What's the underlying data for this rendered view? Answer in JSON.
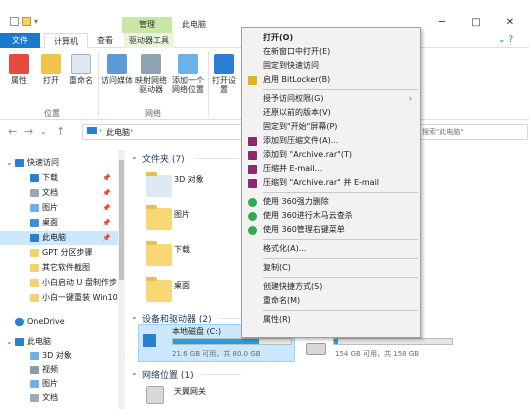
{
  "window": {
    "title": "此电脑",
    "context_tab": "管理",
    "controls": [
      "─",
      "□",
      "✕"
    ]
  },
  "ribbon_tabs": {
    "file": "文件",
    "computer": "计算机",
    "view": "查看",
    "drive_tools": "驱动器工具"
  },
  "ribbon": {
    "properties": "属性",
    "open": "打开",
    "rename": "重命名",
    "access_media": "访问媒体",
    "map_drive": "映射网络驱动器",
    "add_location": "添加一个网络位置",
    "open_settings": "打开设置",
    "group_location": "位置",
    "group_network": "网络"
  },
  "address": {
    "path": "此电脑",
    "search_placeholder": "搜索\"此电脑\""
  },
  "nav": {
    "quick_access": "快速访问",
    "items": [
      {
        "label": "下载",
        "pin": "📌"
      },
      {
        "label": "文档",
        "pin": "📌"
      },
      {
        "label": "图片",
        "pin": "📌"
      },
      {
        "label": "桌面",
        "pin": "📌"
      },
      {
        "label": "此电脑",
        "pin": "📌"
      },
      {
        "label": "GPT 分区步骤",
        "pin": ""
      },
      {
        "label": "其它软件截图",
        "pin": ""
      },
      {
        "label": "小白启动 U 盘制作步",
        "pin": ""
      },
      {
        "label": "小白一键重装 Win10",
        "pin": ""
      }
    ],
    "onedrive": "OneDrive",
    "this_pc": "此电脑",
    "pc_items": [
      "3D 对象",
      "视频",
      "图片",
      "文档"
    ]
  },
  "content": {
    "folders_header": "文件夹 (7)",
    "folders": [
      "3D 对象",
      "图片",
      "下载",
      "桌面"
    ],
    "devices_header": "设备和驱动器 (2)",
    "drives": [
      {
        "name": "本地磁盘 (C:)",
        "free": "21.6 GB 可用，共 80.0 GB",
        "used_ratio": 0.73
      },
      {
        "name": "",
        "free": "154 GB 可用，共 158 GB",
        "used_ratio": 0.03
      }
    ],
    "network_header": "网络位置 (1)",
    "network_items": [
      "天翼网关"
    ]
  },
  "context_menu": {
    "items": [
      {
        "label": "打开(O)",
        "icon": "",
        "bold": true
      },
      {
        "label": "在新窗口中打开(E)",
        "icon": ""
      },
      {
        "label": "固定到快速访问",
        "icon": ""
      },
      {
        "label": "启用 BitLocker(B)",
        "icon": "shield-icon"
      },
      {
        "sep": true
      },
      {
        "label": "授予访问权限(G)",
        "icon": "",
        "submenu": "›"
      },
      {
        "label": "还原以前的版本(V)",
        "icon": ""
      },
      {
        "label": "固定到\"开始\"屏幕(P)",
        "icon": ""
      },
      {
        "label": "添加到压缩文件(A)...",
        "icon": "winrar-icon"
      },
      {
        "label": "添加到 \"Archive.rar\"(T)",
        "icon": "winrar-icon"
      },
      {
        "label": "压缩并 E-mail...",
        "icon": "winrar-icon"
      },
      {
        "label": "压缩到 \"Archive.rar\" 并 E-mail",
        "icon": "winrar-icon"
      },
      {
        "sep": true
      },
      {
        "label": "使用 360强力删除",
        "icon": "360-icon"
      },
      {
        "label": "使用 360进行木马云查杀",
        "icon": "360-icon"
      },
      {
        "label": "使用 360管理右键菜单",
        "icon": "360-icon"
      },
      {
        "sep": true
      },
      {
        "label": "格式化(A)...",
        "icon": ""
      },
      {
        "sep": true
      },
      {
        "label": "复制(C)",
        "icon": ""
      },
      {
        "sep": true
      },
      {
        "label": "创建快捷方式(S)",
        "icon": ""
      },
      {
        "label": "重命名(M)",
        "icon": ""
      },
      {
        "sep": true
      },
      {
        "label": "属性(R)",
        "icon": ""
      }
    ]
  },
  "colors": {
    "accent": "#1979ca",
    "selection": "#cce8ff",
    "drive_fill": "#26a0da",
    "context_tab": "#c8e6a4"
  }
}
